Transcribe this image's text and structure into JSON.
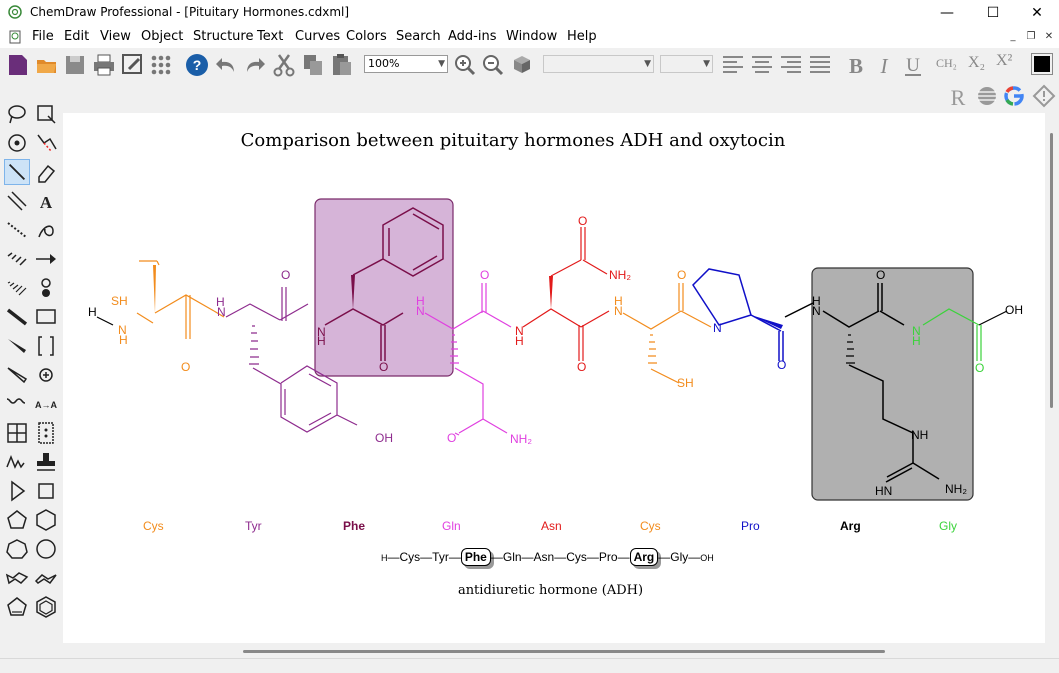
{
  "window": {
    "title": "ChemDraw Professional - [Pituitary Hormones.cdxml]",
    "minimize": "—",
    "maximize": "☐",
    "close": "✕"
  },
  "menu": [
    "File",
    "Edit",
    "View",
    "Object",
    "Structure",
    "Text",
    "Curves",
    "Colors",
    "Search",
    "Add-ins",
    "Window",
    "Help"
  ],
  "toolbar": {
    "zoom": "100%",
    "font": "",
    "size": "",
    "ch2_label": "CH₂",
    "sub_label": "X₂",
    "sup_label": "X²"
  },
  "document": {
    "heading": "Comparison between pituitary hormones ADH and oxytocin",
    "caption": "antidiuretic hormone (ADH)",
    "residues": [
      {
        "name": "Cys",
        "color": "#f28c1d",
        "bold": false
      },
      {
        "name": "Tyr",
        "color": "#8e2c8e",
        "bold": false
      },
      {
        "name": "Phe",
        "color": "#7a0f4a",
        "bold": true
      },
      {
        "name": "Gln",
        "color": "#e040e0",
        "bold": false
      },
      {
        "name": "Asn",
        "color": "#e21a1a",
        "bold": false
      },
      {
        "name": "Cys",
        "color": "#f28c1d",
        "bold": false
      },
      {
        "name": "Pro",
        "color": "#1010c8",
        "bold": false
      },
      {
        "name": "Arg",
        "color": "#000000",
        "bold": true
      },
      {
        "name": "Gly",
        "color": "#3bd33b",
        "bold": false
      }
    ],
    "sequence": {
      "start": "H",
      "end": "OH",
      "items": [
        "Cys",
        "Tyr",
        "Phe",
        "Gln",
        "Asn",
        "Cys",
        "Pro",
        "Arg",
        "Gly"
      ],
      "boxed": [
        "Phe",
        "Arg"
      ]
    },
    "atom_labels": {
      "sh": "SH",
      "h": "H",
      "nh": "N",
      "h_below": "H",
      "o": "O",
      "n": "N",
      "nh2": "NH₂",
      "oh": "OH",
      "hn": "HN",
      "nh_label": "NH"
    }
  }
}
